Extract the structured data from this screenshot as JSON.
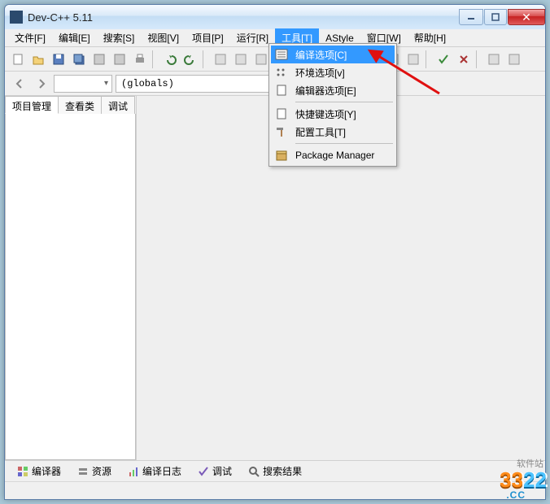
{
  "window": {
    "title": "Dev-C++ 5.11"
  },
  "menus": [
    {
      "label": "文件[F]"
    },
    {
      "label": "编辑[E]"
    },
    {
      "label": "搜索[S]"
    },
    {
      "label": "视图[V]"
    },
    {
      "label": "项目[P]"
    },
    {
      "label": "运行[R]"
    },
    {
      "label": "工具[T]",
      "active": true
    },
    {
      "label": "AStyle"
    },
    {
      "label": "窗口[W]"
    },
    {
      "label": "帮助[H]"
    }
  ],
  "toolbar2": {
    "combo1": "",
    "combo2": "(globals)"
  },
  "sidebar": {
    "tabs": [
      {
        "label": "项目管理",
        "active": true
      },
      {
        "label": "查看类",
        "active": false
      },
      {
        "label": "调试",
        "active": false
      }
    ]
  },
  "tools_menu": [
    {
      "icon": "list",
      "label": "编译选项[C]",
      "selected": true
    },
    {
      "icon": "dots",
      "label": "环境选项[v]"
    },
    {
      "icon": "page",
      "label": "编辑器选项[E]"
    },
    {
      "sep": true
    },
    {
      "icon": "page",
      "label": "快捷键选项[Y]"
    },
    {
      "icon": "hammer",
      "label": "配置工具[T]"
    },
    {
      "sep": true
    },
    {
      "icon": "pkg",
      "label": "Package Manager"
    }
  ],
  "bottom_tabs": [
    {
      "icon": "grid",
      "label": "编译器"
    },
    {
      "icon": "stack",
      "label": "资源"
    },
    {
      "icon": "bars",
      "label": "编译日志"
    },
    {
      "icon": "check",
      "label": "调试"
    },
    {
      "icon": "search",
      "label": "搜索结果"
    }
  ],
  "watermark": {
    "sub": "软件站",
    "main": "3322",
    "cc": ".CC"
  }
}
